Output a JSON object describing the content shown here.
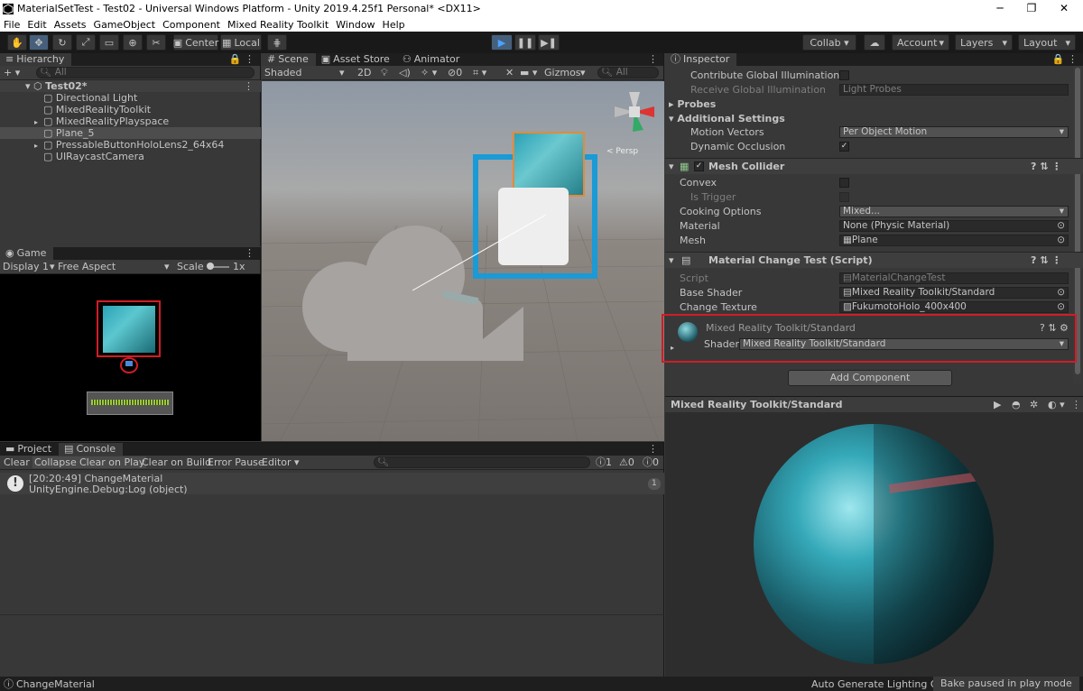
{
  "window": {
    "title": "MaterialSetTest - Test02 - Universal Windows Platform - Unity 2019.4.25f1 Personal* <DX11>",
    "minimize": "─",
    "maximize": "❐",
    "close": "✕"
  },
  "menu": [
    "File",
    "Edit",
    "Assets",
    "GameObject",
    "Component",
    "Mixed Reality Toolkit",
    "Window",
    "Help"
  ],
  "toolbar": {
    "pivot": "Center",
    "space": "Local",
    "collab": "Collab ▾",
    "account": "Account",
    "layers": "Layers",
    "layout": "Layout"
  },
  "hierarchy": {
    "tab": "Hierarchy",
    "search": "All",
    "add": "+ ▾",
    "scene": "Test02*",
    "items": [
      {
        "label": "Directional Light",
        "fold": false
      },
      {
        "label": "MixedRealityToolkit",
        "fold": false
      },
      {
        "label": "MixedRealityPlayspace",
        "fold": true
      },
      {
        "label": "Plane_5",
        "fold": false,
        "selected": true
      },
      {
        "label": "PressableButtonHoloLens2_64x64",
        "fold": true
      },
      {
        "label": "UIRaycastCamera",
        "fold": false
      }
    ]
  },
  "game": {
    "tab": "Game",
    "display": "Display 1",
    "aspect": "Free Aspect",
    "scale_label": "Scale",
    "scale": "1x"
  },
  "scene": {
    "tabs": [
      "Scene",
      "Asset Store",
      "Animator"
    ],
    "shading": "Shaded",
    "mode2d": "2D",
    "fx": "0",
    "gizmos": "Gizmos",
    "search": "All",
    "persp": "< Persp"
  },
  "console": {
    "tabs": [
      "Project",
      "Console"
    ],
    "buttons": [
      "Clear",
      "Collapse",
      "Clear on Play",
      "Clear on Build",
      "Error Pause",
      "Editor"
    ],
    "counts": {
      "info": "1",
      "warn": "0",
      "error": "0"
    },
    "entries": [
      {
        "line1": "[20:20:49] ChangeMaterial",
        "line2": "UnityEngine.Debug:Log (object)",
        "count": "1"
      }
    ]
  },
  "inspector": {
    "tab": "Inspector",
    "lighting": [
      {
        "label": "Contribute Global Illumination",
        "checked": false
      },
      {
        "label": "Receive Global Illumination",
        "value": "Light Probes",
        "disabled": true
      }
    ],
    "probes": "Probes",
    "additional": "Additional Settings",
    "motion_vectors": {
      "label": "Motion Vectors",
      "value": "Per Object Motion"
    },
    "dynamic_occlusion": {
      "label": "Dynamic Occlusion",
      "checked": true
    },
    "mesh_collider": {
      "title": "Mesh Collider",
      "convex": "Convex",
      "is_trigger": "Is Trigger",
      "cooking_label": "Cooking Options",
      "cooking": "Mixed...",
      "material_label": "Material",
      "material": "None (Physic Material)",
      "mesh_label": "Mesh",
      "mesh": "Plane"
    },
    "script_comp": {
      "title": "Material Change Test (Script)",
      "script_label": "Script",
      "script": "MaterialChangeTest",
      "base_shader_label": "Base Shader",
      "base_shader": "Mixed Reality Toolkit/Standard",
      "change_texture_label": "Change Texture",
      "change_texture": "FukumotoHolo_400x400"
    },
    "material": {
      "name": "Mixed Reality Toolkit/Standard",
      "shader_label": "Shader",
      "shader": "Mixed Reality Toolkit/Standard"
    },
    "add_component": "Add Component",
    "preview_title": "Mixed Reality Toolkit/Standard"
  },
  "status": {
    "message": "ChangeMaterial",
    "auto_lighting": "Auto Generate Lighting Off",
    "bake": "Bake paused in play mode"
  },
  "colors": {
    "accent": "#46607c",
    "highlight": "#d11c26",
    "selection_blue": "#1a9ad6"
  }
}
